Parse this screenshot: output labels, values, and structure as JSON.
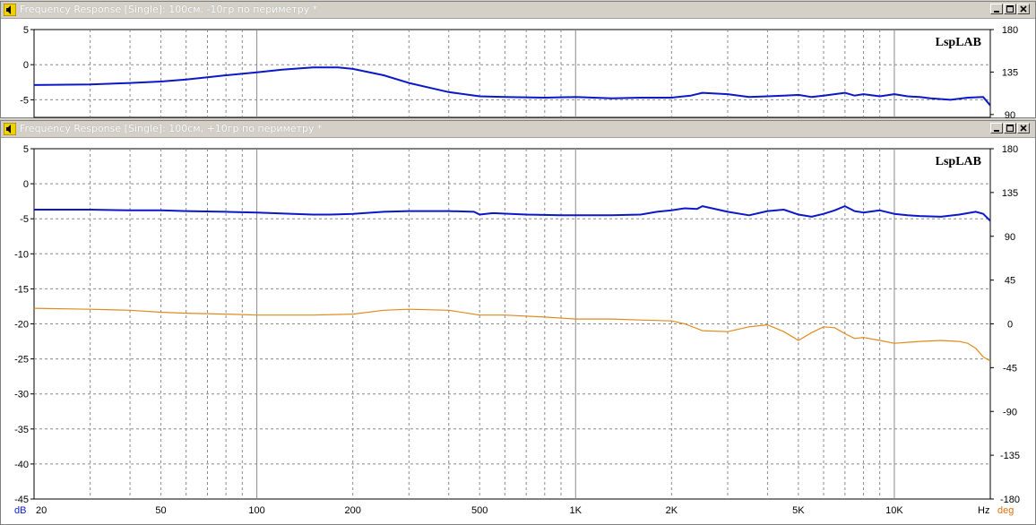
{
  "windows": [
    {
      "title": "Frequency Response [Single]: 100см. -10гр по периметру *",
      "watermark": "LspLAB",
      "left_ticks": [
        "5",
        "0",
        "-5"
      ],
      "left_tick_values": [
        5,
        0,
        -5
      ],
      "right_ticks": [
        "180",
        "135",
        "90"
      ],
      "right_tick_values": [
        180,
        135,
        90
      ]
    },
    {
      "title": "Frequency Response [Single]: 100см, +10гр по периметру *",
      "watermark": "LspLAB",
      "left_ticks": [
        "5",
        "0",
        "-5",
        "-10",
        "-15",
        "-20",
        "-25",
        "-30",
        "-35",
        "-40",
        "-45"
      ],
      "left_tick_values": [
        5,
        0,
        -5,
        -10,
        -15,
        -20,
        -25,
        -30,
        -35,
        -40,
        -45
      ],
      "right_ticks": [
        "180",
        "135",
        "90",
        "45",
        "0",
        "-45",
        "-90",
        "-135",
        "-180"
      ],
      "right_tick_values": [
        180,
        135,
        90,
        45,
        0,
        -45,
        -90,
        -135,
        -180
      ],
      "x_ticks": [
        "20",
        "50",
        "100",
        "200",
        "500",
        "1K",
        "2K",
        "5K",
        "10K"
      ],
      "x_tick_values": [
        20,
        50,
        100,
        200,
        500,
        1000,
        2000,
        5000,
        10000
      ],
      "x_unit": "Hz",
      "left_unit": "dB",
      "right_unit": "deg"
    }
  ],
  "colors": {
    "magnitude": "#0b18c8",
    "phase": "#e08a1e",
    "grid": "#9a9a9a",
    "axis_text": "#000000",
    "left_unit": "#1020d0",
    "right_unit": "#e07010",
    "title_bg": "#d4d0c8"
  },
  "chart_data": [
    {
      "type": "line",
      "title": "Frequency Response [Single]: 100см. -10гр по периметру *",
      "x_scale": "log",
      "xlim": [
        20,
        20000
      ],
      "ylim_left": [
        -7.5,
        5
      ],
      "ylim_right": [
        87,
        180
      ],
      "series": [
        {
          "axis": "left",
          "x": [
            20,
            30,
            40,
            50,
            60,
            70,
            80,
            100,
            120,
            150,
            180,
            200,
            250,
            300,
            400,
            500,
            600,
            800,
            1000,
            1300,
            1600,
            2000,
            2300,
            2500,
            3000,
            3500,
            4000,
            4500,
            5000,
            5500,
            6000,
            6500,
            7000,
            7500,
            8000,
            9000,
            10000,
            11000,
            12000,
            13000,
            15000,
            17000,
            19000,
            20000
          ],
          "y": [
            -2.9,
            -2.8,
            -2.6,
            -2.4,
            -2.1,
            -1.8,
            -1.5,
            -1.1,
            -0.7,
            -0.4,
            -0.4,
            -0.6,
            -1.5,
            -2.6,
            -3.9,
            -4.5,
            -4.6,
            -4.7,
            -4.6,
            -4.8,
            -4.7,
            -4.7,
            -4.4,
            -4.0,
            -4.2,
            -4.6,
            -4.5,
            -4.4,
            -4.3,
            -4.6,
            -4.4,
            -4.2,
            -4.0,
            -4.4,
            -4.2,
            -4.5,
            -4.2,
            -4.5,
            -4.6,
            -4.8,
            -5.0,
            -4.7,
            -4.6,
            -5.8
          ]
        }
      ]
    },
    {
      "type": "line",
      "title": "Frequency Response [Single]: 100см, +10гр по периметру *",
      "x_scale": "log",
      "xlim": [
        20,
        20000
      ],
      "ylim_left": [
        -45,
        5
      ],
      "ylim_right": [
        -180,
        180
      ],
      "x_ticks": [
        "20",
        "50",
        "100",
        "200",
        "500",
        "1K",
        "2K",
        "5K",
        "10K"
      ],
      "xlabel": "Hz",
      "ylabel": "dB",
      "ylabel_right": "deg",
      "series": [
        {
          "axis": "left",
          "x": [
            20,
            30,
            40,
            50,
            60,
            80,
            100,
            130,
            150,
            170,
            200,
            250,
            300,
            400,
            480,
            500,
            550,
            700,
            900,
            1000,
            1300,
            1600,
            1800,
            2000,
            2200,
            2400,
            2500,
            3000,
            3500,
            4000,
            4500,
            5000,
            5500,
            6000,
            6500,
            7000,
            7500,
            8000,
            9000,
            10000,
            11000,
            12000,
            14000,
            16000,
            18000,
            19000,
            20000
          ],
          "y": [
            -3.7,
            -3.7,
            -3.8,
            -3.8,
            -3.9,
            -4.0,
            -4.1,
            -4.3,
            -4.4,
            -4.4,
            -4.3,
            -4.0,
            -3.9,
            -3.9,
            -4.0,
            -4.4,
            -4.2,
            -4.4,
            -4.5,
            -4.5,
            -4.5,
            -4.4,
            -4.0,
            -3.8,
            -3.5,
            -3.6,
            -3.2,
            -4.0,
            -4.5,
            -3.9,
            -3.7,
            -4.4,
            -4.7,
            -4.3,
            -3.8,
            -3.2,
            -3.9,
            -4.1,
            -3.8,
            -4.3,
            -4.5,
            -4.6,
            -4.7,
            -4.4,
            -4.0,
            -4.3,
            -5.3
          ]
        },
        {
          "axis": "right",
          "x": [
            20,
            30,
            40,
            50,
            60,
            80,
            100,
            130,
            150,
            200,
            250,
            300,
            400,
            500,
            600,
            800,
            1000,
            1300,
            1600,
            2000,
            2200,
            2500,
            3000,
            3500,
            4000,
            4500,
            5000,
            5500,
            6000,
            6500,
            7000,
            7500,
            8000,
            9000,
            10000,
            11000,
            12000,
            14000,
            16000,
            17000,
            18000,
            19000,
            20000
          ],
          "y": [
            16,
            15,
            14,
            12,
            11,
            10,
            9,
            9,
            9,
            10,
            14,
            15,
            14,
            9,
            9,
            7,
            5,
            5,
            4,
            3,
            0,
            -7,
            -8,
            -3,
            -1,
            -8,
            -17,
            -9,
            -3,
            -4,
            -10,
            -15,
            -14,
            -17,
            -20,
            -19,
            -18,
            -17,
            -18,
            -20,
            -25,
            -34,
            -38
          ]
        }
      ]
    }
  ]
}
